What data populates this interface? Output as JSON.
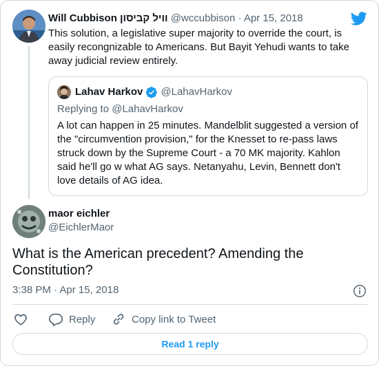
{
  "colors": {
    "accent": "#1d9bf0",
    "text": "#0f1419",
    "muted": "#536471",
    "border": "#cfd9de"
  },
  "parent_tweet": {
    "display_name": "Will Cubbison וויל קביסון",
    "handle": "@wccubbison",
    "separator": "·",
    "date": "Apr 15, 2018",
    "text": "This solution, a legislative super majority to override the court, is easily recongnizable to Americans. But Bayit Yehudi wants to take away judicial review entirely."
  },
  "quoted_tweet": {
    "display_name": "Lahav Harkov",
    "verified": true,
    "handle": "@LahavHarkov",
    "replying_to": "Replying to @LahavHarkov",
    "text": "A lot can happen in 25 minutes. Mandelblit suggested a version of the \"circumvention provision,\" for the Knesset to re-pass laws struck down by the Supreme Court - a 70 MK majority. Kahlon said he'll go w what AG says. Netanyahu, Levin, Bennett don't love details of AG idea."
  },
  "main_tweet": {
    "display_name": "maor eichler",
    "handle": "@EichlerMaor",
    "text": "What is the American precedent? Amending the Constitution?",
    "time": "3:38 PM",
    "separator": "·",
    "date": "Apr 15, 2018"
  },
  "actions": {
    "reply_label": "Reply",
    "copy_link_label": "Copy link to Tweet"
  },
  "read_replies_label": "Read 1 reply",
  "icons": {
    "logo": "twitter-bird-icon",
    "verified": "verified-badge-icon",
    "info": "info-icon",
    "like": "heart-icon",
    "reply": "speech-bubble-icon",
    "copy": "link-icon"
  }
}
